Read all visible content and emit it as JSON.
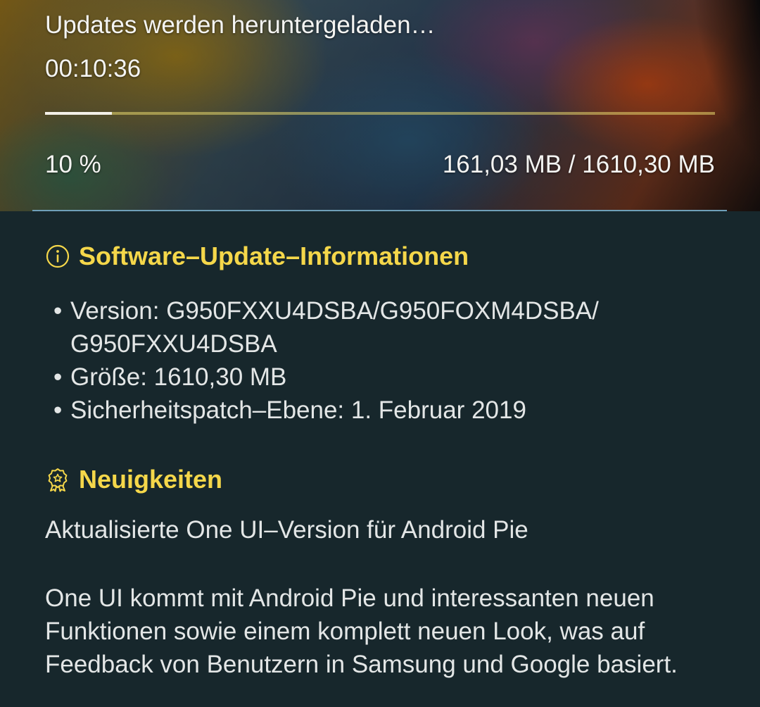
{
  "download": {
    "title": "Updates werden heruntergeladen…",
    "elapsed": "00:10:36",
    "progress_fraction": 0.1,
    "percent_label": "10 %",
    "size_label": "161,03 MB / 1610,30 MB"
  },
  "info": {
    "icon": "info-circle-icon",
    "heading": "Software–Update–Informationen",
    "bullet_symbol": "•",
    "version": "Version: G950FXXU4DSBA/G950FOXM4DSBA/ G950FXXU4DSBA",
    "size": "Größe: 1610,30 MB",
    "patch": "Sicherheitspatch–Ebene: 1. Februar 2019"
  },
  "news": {
    "icon": "award-badge-icon",
    "heading": "Neuigkeiten",
    "subtitle": "Aktualisierte One UI–Version für Android Pie",
    "body": "One UI kommt mit Android Pie und interessanten neuen Funktionen sowie einem komplett neuen Look, was auf Feedback von Benutzern in Samsung und Google basiert."
  },
  "colors": {
    "background": "#17272c",
    "accent_heading": "#f5d74a",
    "divider": "#6f9fb8",
    "text": "#e3e6e6",
    "progress_track": "#e6d76e",
    "progress_fill": "#f3f0e8"
  }
}
